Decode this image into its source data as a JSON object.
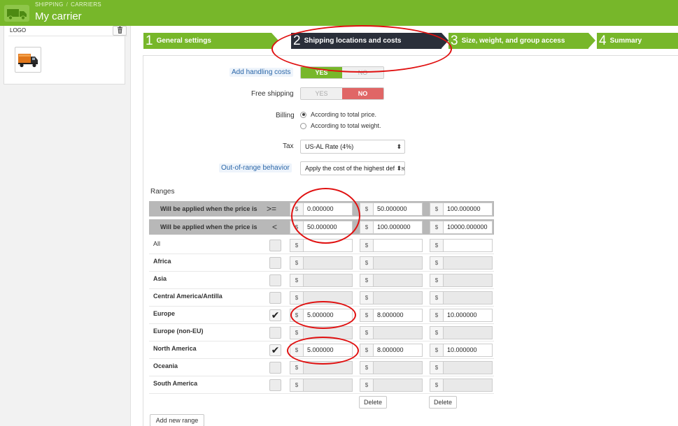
{
  "header": {
    "breadcrumb": [
      "SHIPPING",
      "CARRIERS"
    ],
    "breadcrumb_sep": "/",
    "title": "My carrier",
    "icon": "truck-icon"
  },
  "sidebar": {
    "logo_label": "LOGO",
    "delete_icon": "trash-icon",
    "logo_image": "truck-image"
  },
  "steps": [
    {
      "number": "1",
      "label": "General settings",
      "active": false
    },
    {
      "number": "2",
      "label": "Shipping locations and costs",
      "active": true
    },
    {
      "number": "3",
      "label": "Size, weight, and group access",
      "active": false
    },
    {
      "number": "4",
      "label": "Summary",
      "active": false
    }
  ],
  "form": {
    "handling": {
      "label": "Add handling costs",
      "yes": "YES",
      "no": "NO",
      "value": "YES"
    },
    "free_shipping": {
      "label": "Free shipping",
      "yes": "YES",
      "no": "NO",
      "value": "NO"
    },
    "billing": {
      "label": "Billing",
      "options": [
        "According to total price.",
        "According to total weight."
      ],
      "selected": 0
    },
    "tax": {
      "label": "Tax",
      "value": "US-AL Rate (4%)"
    },
    "out_of_range": {
      "label": "Out-of-range behavior",
      "value": "Apply the cost of the highest defined range"
    }
  },
  "ranges": {
    "title": "Ranges",
    "currency": "$",
    "header_rows": [
      {
        "label": "Will be applied when the price is",
        "operator": ">=",
        "values": [
          "0.000000",
          "50.000000",
          "100.000000"
        ]
      },
      {
        "label": "Will be applied when the price is",
        "operator": "<",
        "values": [
          "50.000000",
          "100.000000",
          "10000.000000"
        ]
      }
    ],
    "zones": [
      {
        "name": "All",
        "checked": false,
        "values": [
          "",
          "",
          ""
        ]
      },
      {
        "name": "Africa",
        "checked": false,
        "values": [
          "",
          "",
          ""
        ]
      },
      {
        "name": "Asia",
        "checked": false,
        "values": [
          "",
          "",
          ""
        ]
      },
      {
        "name": "Central America/Antilla",
        "checked": false,
        "values": [
          "",
          "",
          ""
        ]
      },
      {
        "name": "Europe",
        "checked": true,
        "values": [
          "5.000000",
          "8.000000",
          "10.000000"
        ]
      },
      {
        "name": "Europe (non-EU)",
        "checked": false,
        "values": [
          "",
          "",
          ""
        ]
      },
      {
        "name": "North America",
        "checked": true,
        "values": [
          "5.000000",
          "8.000000",
          "10.000000"
        ]
      },
      {
        "name": "Oceania",
        "checked": false,
        "values": [
          "",
          "",
          ""
        ]
      },
      {
        "name": "South America",
        "checked": false,
        "values": [
          "",
          "",
          ""
        ]
      }
    ],
    "delete_label": "Delete",
    "add_range_label": "Add new range"
  },
  "colors": {
    "brand_green": "#77b72a",
    "active_step": "#2a2f3a",
    "no_red": "#e06666",
    "annotation_red": "#e01010"
  }
}
